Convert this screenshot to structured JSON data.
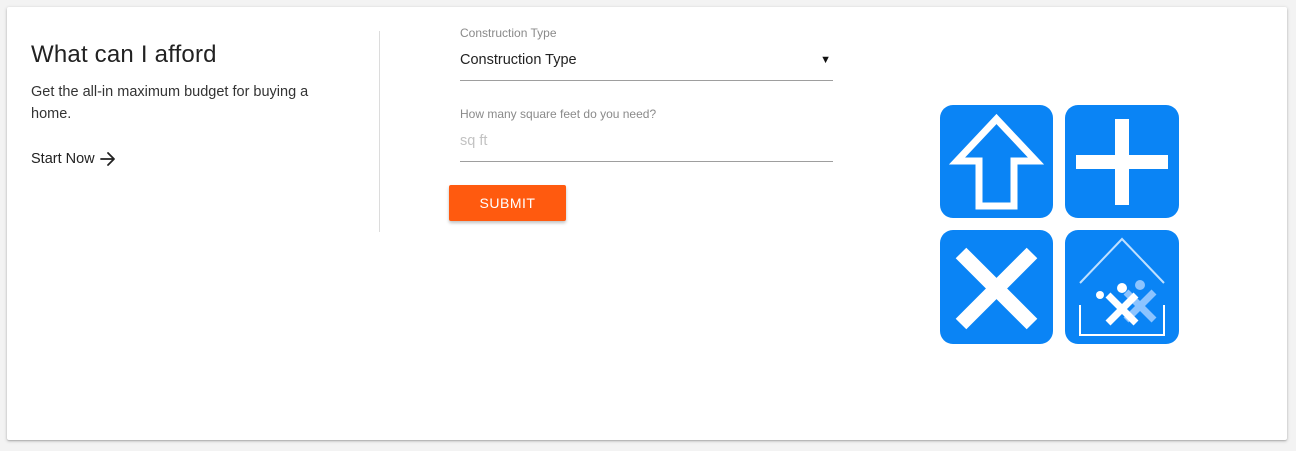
{
  "intro": {
    "title": "What can I afford",
    "description": "Get the all-in maximum budget for buying a home.",
    "start_link": "Start Now"
  },
  "form": {
    "construction_type": {
      "label": "Construction Type",
      "selected_value": "Construction Type"
    },
    "square_feet": {
      "label": "How many square feet do you need?",
      "value": "",
      "placeholder": "sq ft"
    },
    "submit_label": "SUBMIT"
  },
  "icons": {
    "start_arrow": "arrow-right-icon",
    "select_caret": "caret-down-icon",
    "logo": "calculator-house-logo"
  },
  "colors": {
    "accent": "#ff5a0f",
    "logo_blue": "#0a84f5"
  }
}
